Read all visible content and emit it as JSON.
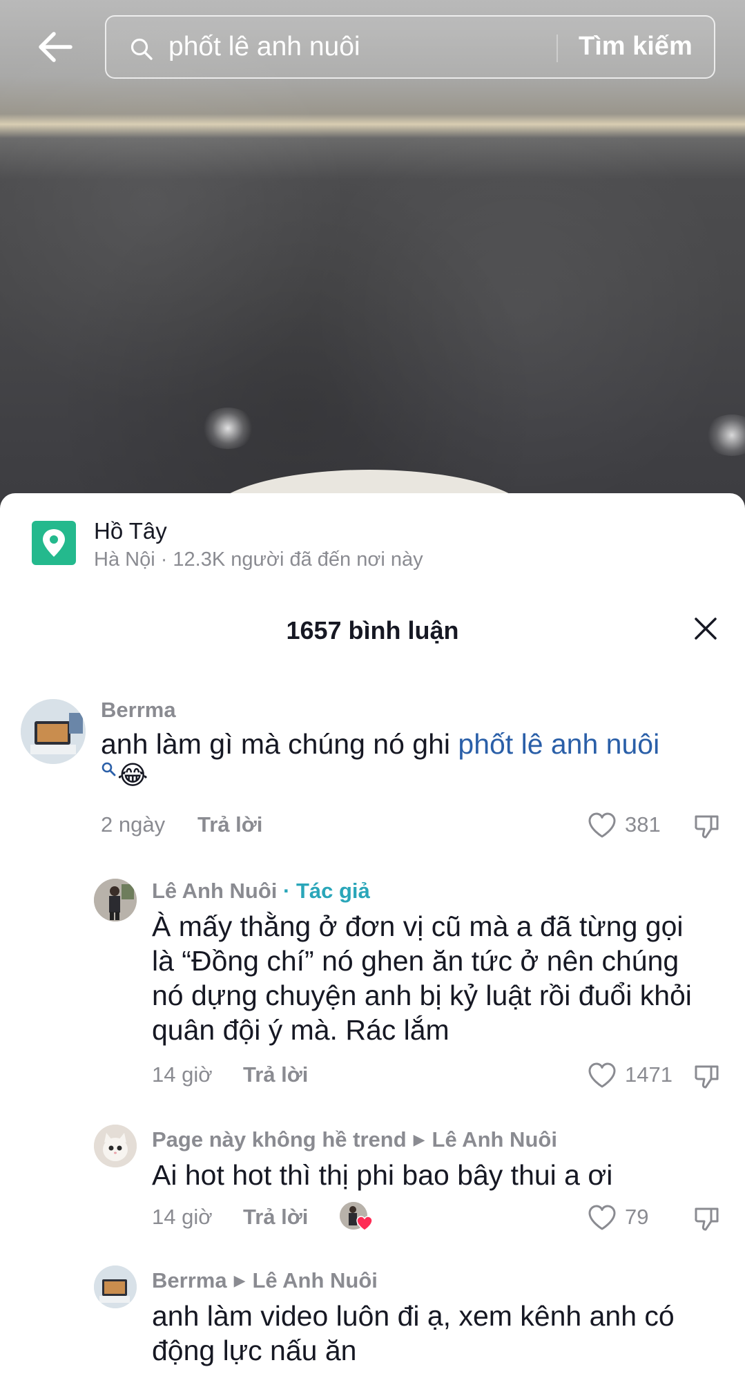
{
  "search": {
    "query": "phốt lê anh nuôi",
    "submit_label": "Tìm kiếm"
  },
  "location": {
    "name": "Hồ Tây",
    "subtitle": "Hà Nội · 12.3K người đã đến nơi này"
  },
  "comments_sheet": {
    "title": "1657 bình luận"
  },
  "comments": [
    {
      "username": "Berrma",
      "text": "anh làm gì mà chúng nó ghi ",
      "link_text": "phốt lê anh nuôi",
      "emoji": "😂",
      "time": "2 ngày",
      "reply_label": "Trả lời",
      "likes": "381"
    },
    {
      "username": "Lê Anh Nuôi",
      "author_tag": " · Tác giả",
      "text": "À mấy thằng ở đơn vị cũ mà a đã từng gọi là “Đồng chí” nó ghen ăn tức ở nên chúng nó dựng chuyện anh bị kỷ luật rồi đuổi khỏi quân đội ý mà. Rác lắm",
      "time": "14 giờ",
      "reply_label": "Trả lời",
      "likes": "1471"
    },
    {
      "username": "Page này không hề trend",
      "reply_to": "Lê Anh Nuôi",
      "text": "Ai hot hot thì thị phi bao bây thui a ơi",
      "time": "14 giờ",
      "reply_label": "Trả lời",
      "likes": "79"
    },
    {
      "username": "Berrma",
      "reply_to": "Lê Anh Nuôi",
      "text": "anh làm video luôn đi ạ, xem kênh anh có động lực nấu ăn"
    }
  ],
  "colors": {
    "link": "#2a5fa8",
    "author_tag": "#2aa6b9",
    "location_icon": "#24b98d",
    "heart_red": "#fe2c55"
  },
  "icons": [
    "back-arrow-icon",
    "search-icon",
    "location-pin-icon",
    "close-icon",
    "heart-icon",
    "dislike-icon",
    "search-small-icon"
  ]
}
